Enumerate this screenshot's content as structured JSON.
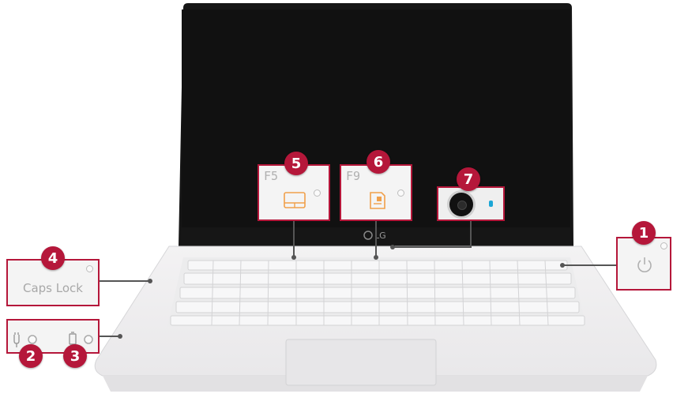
{
  "callouts": {
    "power": {
      "number": "1",
      "icon": "power-icon"
    },
    "ac_battery_leds": {
      "left_number": "2",
      "right_number": "3",
      "left_icon": "ac-adapter-icon",
      "right_icon": "battery-icon"
    },
    "caps_lock": {
      "number": "4",
      "label": "Caps Lock"
    },
    "touchpad_key": {
      "number": "5",
      "key": "F5",
      "icon": "touchpad-icon"
    },
    "reader_mode_key": {
      "number": "6",
      "key": "F9",
      "icon": "reader-mode-icon"
    },
    "webcam": {
      "number": "7",
      "icon": "webcam-icon"
    }
  },
  "laptop": {
    "logo": "LG",
    "brand_color": "#b5173a",
    "screen_color": "#151515"
  }
}
